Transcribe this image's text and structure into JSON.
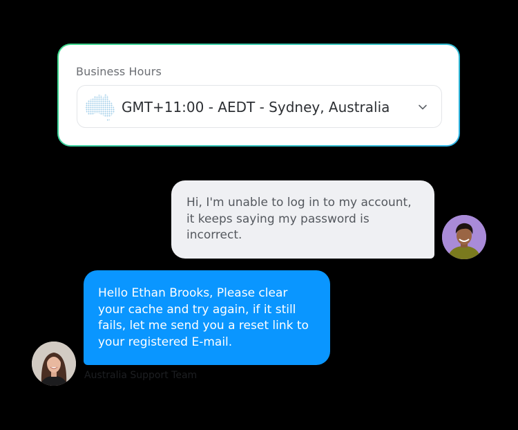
{
  "business_hours": {
    "label": "Business Hours",
    "timezone_value": "GMT+11:00 - AEDT - Sydney, Australia",
    "region_icon": "australia-map-icon",
    "dropdown_icon": "chevron-down-icon"
  },
  "chat": {
    "user_message": "Hi, I'm unable to log in to my account, it keeps saying my password is incorrect.",
    "agent_message": "Hello Ethan Brooks, Please clear your cache and try again, if it still fails, let me send you a reset link to your registered E-mail.",
    "agent_team": "Australia Support Team"
  },
  "colors": {
    "card_border_start": "#3fd98a",
    "card_border_end": "#2fb5e9",
    "user_bubble": "#eff0f3",
    "agent_bubble": "#0a96ff",
    "background": "#000000"
  }
}
